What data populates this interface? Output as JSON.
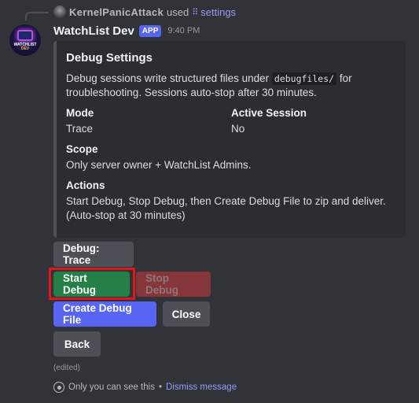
{
  "reply": {
    "user": "KernelPanicAttack",
    "used_text": "used",
    "command": "settings",
    "command_icon": "slash-command-icon"
  },
  "message": {
    "bot_name": "WatchList Dev",
    "badge": "APP",
    "timestamp": "9:40 PM",
    "avatar_text": "WATCHLIST",
    "avatar_sub": "DEV"
  },
  "embed": {
    "title": "Debug Settings",
    "desc_prefix": "Debug sessions write structured files under",
    "desc_code": "debugfiles/",
    "desc_suffix": "for troubleshooting. Sessions auto-stop after 30 minutes.",
    "fields": {
      "mode_name": "Mode",
      "mode_value": "Trace",
      "active_name": "Active Session",
      "active_value": "No",
      "scope_name": "Scope",
      "scope_value": "Only server owner + WatchList Admins.",
      "actions_name": "Actions",
      "actions_value": "Start Debug, Stop Debug, then Create Debug File to zip and deliver. (Auto-stop at 30 minutes)"
    }
  },
  "buttons": {
    "mode_select": "Debug: Trace",
    "start_debug": "Start Debug",
    "stop_debug": "Stop Debug",
    "create_debug_file": "Create Debug File",
    "close": "Close",
    "back": "Back"
  },
  "footer": {
    "edited": "(edited)",
    "ephemeral_note": "Only you can see this",
    "separator": "•",
    "dismiss": "Dismiss message"
  },
  "colors": {
    "background": "#323339",
    "embed_bg": "#2b2d31",
    "accent": "#5865f2",
    "success": "#248046",
    "danger": "#da373c",
    "highlight": "#e0161b"
  }
}
